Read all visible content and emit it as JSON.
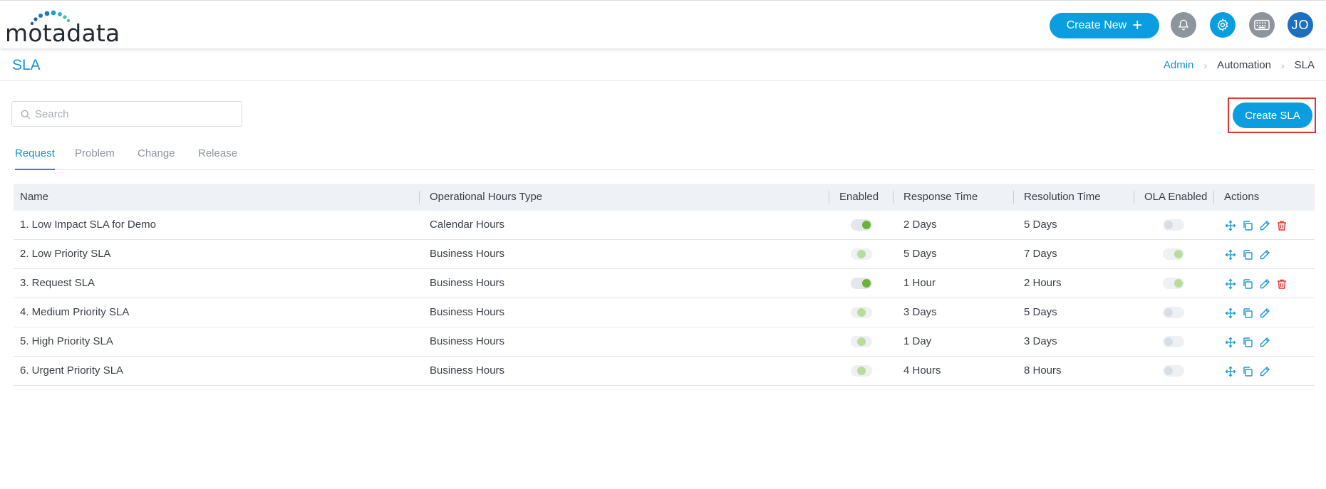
{
  "app": {
    "logo_text": "motadata"
  },
  "header": {
    "create_new_label": "Create New",
    "avatar_initials": "JO"
  },
  "page": {
    "title": "SLA"
  },
  "breadcrumb": [
    "Admin",
    "Automation",
    "SLA"
  ],
  "search": {
    "placeholder": "Search",
    "value": ""
  },
  "create_sla_label": "Create SLA",
  "tabs": [
    {
      "label": "Request",
      "active": true
    },
    {
      "label": "Problem",
      "active": false
    },
    {
      "label": "Change",
      "active": false
    },
    {
      "label": "Release",
      "active": false
    }
  ],
  "table": {
    "columns": [
      "Name",
      "Operational Hours Type",
      "Enabled",
      "Response Time",
      "Resolution Time",
      "OLA Enabled",
      "Actions"
    ],
    "rows": [
      {
        "name": "1. Low Impact SLA for Demo",
        "hours": "Calendar Hours",
        "enabled": "on",
        "response": "2 Days",
        "resolution": "5 Days",
        "ola": "off",
        "delete": true
      },
      {
        "name": "2. Low Priority SLA",
        "hours": "Business Hours",
        "enabled": "light",
        "response": "5 Days",
        "resolution": "7 Days",
        "ola": "on",
        "delete": false
      },
      {
        "name": "3. Request SLA",
        "hours": "Business Hours",
        "enabled": "on",
        "response": "1 Hour",
        "resolution": "2 Hours",
        "ola": "on",
        "delete": true
      },
      {
        "name": "4. Medium Priority SLA",
        "hours": "Business Hours",
        "enabled": "light",
        "response": "3 Days",
        "resolution": "5 Days",
        "ola": "off",
        "delete": false
      },
      {
        "name": "5. High Priority SLA",
        "hours": "Business Hours",
        "enabled": "light",
        "response": "1 Day",
        "resolution": "3 Days",
        "ola": "off",
        "delete": false
      },
      {
        "name": "6. Urgent Priority SLA",
        "hours": "Business Hours",
        "enabled": "light",
        "response": "4 Hours",
        "resolution": "8 Hours",
        "ola": "off",
        "delete": false
      }
    ]
  },
  "icons": {
    "notifications": "bell-icon",
    "settings": "gear-icon",
    "shortcuts": "keyboard-icon",
    "search": "search-icon",
    "row_actions": [
      "move-icon",
      "copy-icon",
      "edit-icon",
      "delete-icon"
    ]
  },
  "colors": {
    "accent": "#0a9ee0",
    "delete": "#e0332f",
    "toggle_on": "#6ab33a"
  }
}
